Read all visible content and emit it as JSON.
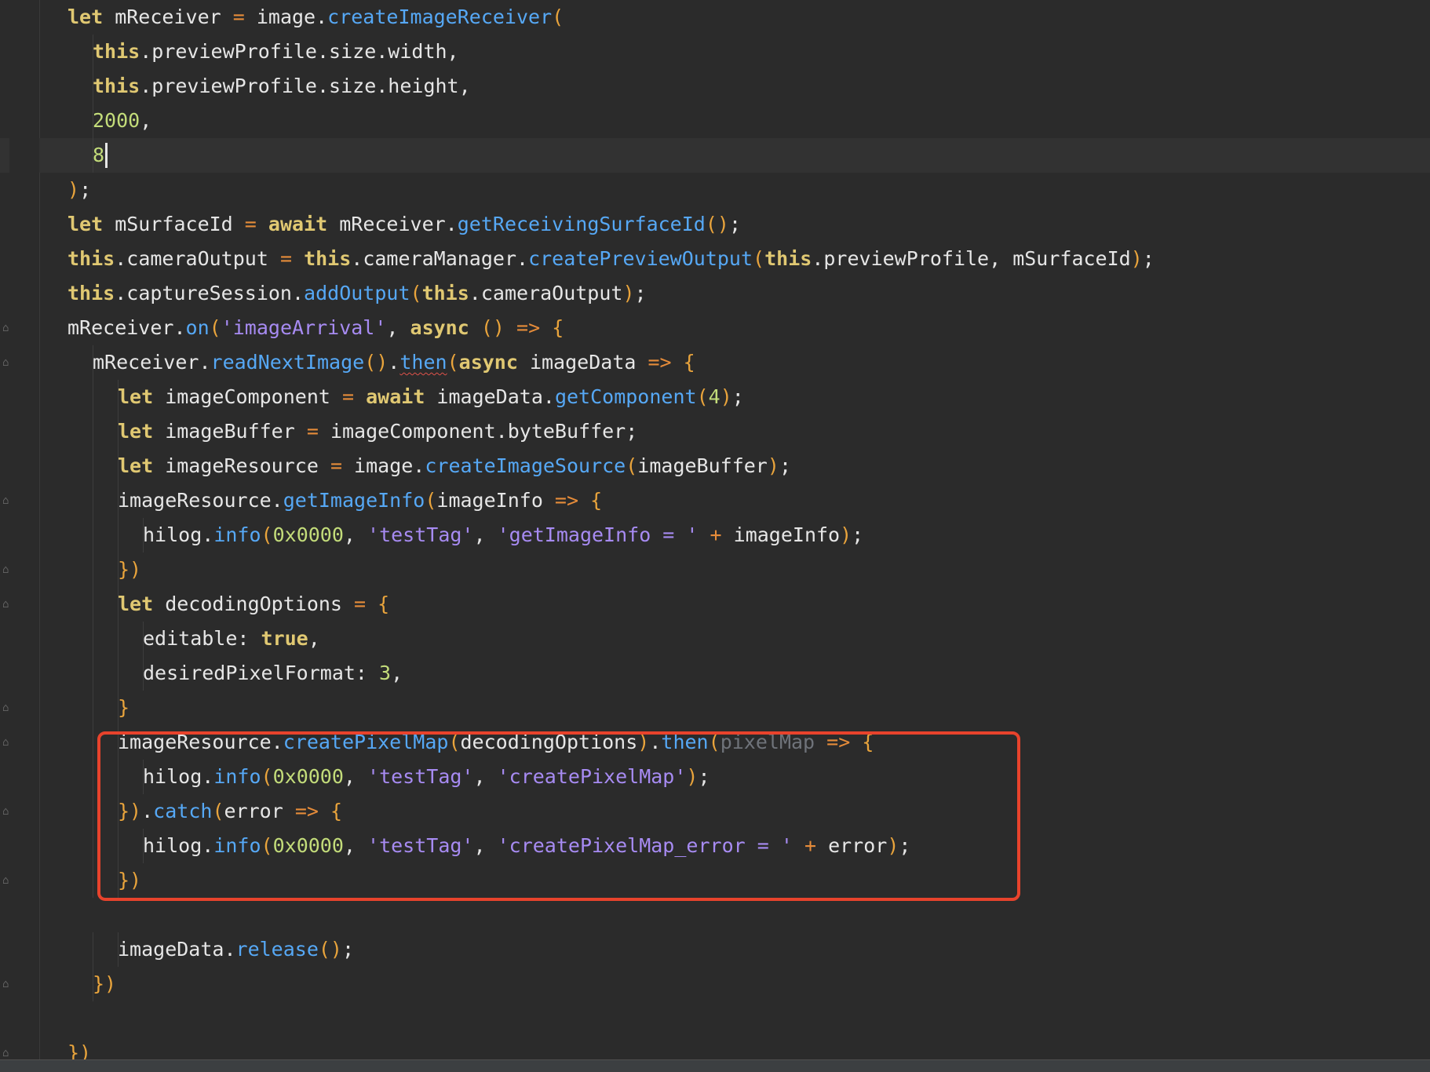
{
  "editor": {
    "highlight_color": "#e8432c",
    "caret_line": 4,
    "colors": {
      "background": "#2b2b2b",
      "keyword": "#e0c872",
      "function": "#56a8f5",
      "string": "#a78bf2",
      "number": "#c3dc7a",
      "bracket": "#e9a43c"
    },
    "lines": [
      {
        "indent": 0,
        "tokens": [
          [
            "kw",
            "let"
          ],
          [
            "pun",
            " mReceiver "
          ],
          [
            "op",
            "="
          ],
          [
            "pun",
            " image."
          ],
          [
            "fn",
            "createImageReceiver"
          ],
          [
            "br",
            "("
          ]
        ]
      },
      {
        "indent": 1,
        "tokens": [
          [
            "kw",
            "this"
          ],
          [
            "pun",
            ".previewProfile.size.width,"
          ]
        ]
      },
      {
        "indent": 1,
        "tokens": [
          [
            "kw",
            "this"
          ],
          [
            "pun",
            ".previewProfile.size.height,"
          ]
        ]
      },
      {
        "indent": 1,
        "tokens": [
          [
            "num",
            "2000"
          ],
          [
            "pun",
            ","
          ]
        ]
      },
      {
        "indent": 1,
        "tokens": [
          [
            "num",
            "8"
          ]
        ]
      },
      {
        "indent": 0,
        "tokens": [
          [
            "br",
            ")"
          ],
          [
            "pun",
            ";"
          ]
        ]
      },
      {
        "indent": 0,
        "tokens": [
          [
            "kw",
            "let"
          ],
          [
            "pun",
            " mSurfaceId "
          ],
          [
            "op",
            "="
          ],
          [
            "pun",
            " "
          ],
          [
            "kw",
            "await"
          ],
          [
            "pun",
            " mReceiver."
          ],
          [
            "fn",
            "getReceivingSurfaceId"
          ],
          [
            "br",
            "()"
          ],
          [
            "pun",
            ";"
          ]
        ]
      },
      {
        "indent": 0,
        "tokens": [
          [
            "kw",
            "this"
          ],
          [
            "pun",
            ".cameraOutput "
          ],
          [
            "op",
            "="
          ],
          [
            "pun",
            " "
          ],
          [
            "kw",
            "this"
          ],
          [
            "pun",
            ".cameraManager."
          ],
          [
            "fn",
            "createPreviewOutput"
          ],
          [
            "br",
            "("
          ],
          [
            "kw",
            "this"
          ],
          [
            "pun",
            ".previewProfile, mSurfaceId"
          ],
          [
            "br",
            ")"
          ],
          [
            "pun",
            ";"
          ]
        ]
      },
      {
        "indent": 0,
        "tokens": [
          [
            "kw",
            "this"
          ],
          [
            "pun",
            ".captureSession."
          ],
          [
            "fn",
            "addOutput"
          ],
          [
            "br",
            "("
          ],
          [
            "kw",
            "this"
          ],
          [
            "pun",
            ".cameraOutput"
          ],
          [
            "br",
            ")"
          ],
          [
            "pun",
            ";"
          ]
        ]
      },
      {
        "indent": 0,
        "tokens": [
          [
            "pun",
            "mReceiver."
          ],
          [
            "fn",
            "on"
          ],
          [
            "br",
            "("
          ],
          [
            "str",
            "'imageArrival'"
          ],
          [
            "pun",
            ", "
          ],
          [
            "kw",
            "async"
          ],
          [
            "pun",
            " "
          ],
          [
            "br",
            "()"
          ],
          [
            "pun",
            " "
          ],
          [
            "op",
            "=>"
          ],
          [
            "pun",
            " "
          ],
          [
            "br",
            "{"
          ]
        ]
      },
      {
        "indent": 1,
        "tokens": [
          [
            "pun",
            "mReceiver."
          ],
          [
            "fn",
            "readNextImage"
          ],
          [
            "br",
            "()"
          ],
          [
            "pun",
            "."
          ],
          [
            "fn squig",
            "then"
          ],
          [
            "br",
            "("
          ],
          [
            "kw",
            "async"
          ],
          [
            "pun",
            " imageData "
          ],
          [
            "op",
            "=>"
          ],
          [
            "pun",
            " "
          ],
          [
            "br",
            "{"
          ]
        ]
      },
      {
        "indent": 2,
        "tokens": [
          [
            "kw",
            "let"
          ],
          [
            "pun",
            " imageComponent "
          ],
          [
            "op",
            "="
          ],
          [
            "pun",
            " "
          ],
          [
            "kw",
            "await"
          ],
          [
            "pun",
            " imageData."
          ],
          [
            "fn",
            "getComponent"
          ],
          [
            "br",
            "("
          ],
          [
            "num",
            "4"
          ],
          [
            "br",
            ")"
          ],
          [
            "pun",
            ";"
          ]
        ]
      },
      {
        "indent": 2,
        "tokens": [
          [
            "kw",
            "let"
          ],
          [
            "pun",
            " imageBuffer "
          ],
          [
            "op",
            "="
          ],
          [
            "pun",
            " imageComponent.byteBuffer;"
          ]
        ]
      },
      {
        "indent": 2,
        "tokens": [
          [
            "kw",
            "let"
          ],
          [
            "pun",
            " imageResource "
          ],
          [
            "op",
            "="
          ],
          [
            "pun",
            " image."
          ],
          [
            "fn",
            "createImageSource"
          ],
          [
            "br",
            "("
          ],
          [
            "pun",
            "imageBuffer"
          ],
          [
            "br",
            ")"
          ],
          [
            "pun",
            ";"
          ]
        ]
      },
      {
        "indent": 2,
        "tokens": [
          [
            "pun",
            "imageResource."
          ],
          [
            "fn",
            "getImageInfo"
          ],
          [
            "br",
            "("
          ],
          [
            "pun",
            "imageInfo "
          ],
          [
            "op",
            "=>"
          ],
          [
            "pun",
            " "
          ],
          [
            "br",
            "{"
          ]
        ]
      },
      {
        "indent": 3,
        "tokens": [
          [
            "pun",
            "hilog."
          ],
          [
            "fn",
            "info"
          ],
          [
            "br",
            "("
          ],
          [
            "num",
            "0x0000"
          ],
          [
            "pun",
            ", "
          ],
          [
            "str",
            "'testTag'"
          ],
          [
            "pun",
            ", "
          ],
          [
            "str",
            "'getImageInfo = '"
          ],
          [
            "pun",
            " "
          ],
          [
            "op",
            "+"
          ],
          [
            "pun",
            " imageInfo"
          ],
          [
            "br",
            ")"
          ],
          [
            "pun",
            ";"
          ]
        ]
      },
      {
        "indent": 2,
        "tokens": [
          [
            "br",
            "})"
          ]
        ]
      },
      {
        "indent": 2,
        "tokens": [
          [
            "kw",
            "let"
          ],
          [
            "pun",
            " decodingOptions "
          ],
          [
            "op",
            "="
          ],
          [
            "pun",
            " "
          ],
          [
            "br",
            "{"
          ]
        ]
      },
      {
        "indent": 3,
        "tokens": [
          [
            "pun",
            "editable: "
          ],
          [
            "kw",
            "true"
          ],
          [
            "pun",
            ","
          ]
        ]
      },
      {
        "indent": 3,
        "tokens": [
          [
            "pun",
            "desiredPixelFormat: "
          ],
          [
            "num",
            "3"
          ],
          [
            "pun",
            ","
          ]
        ]
      },
      {
        "indent": 2,
        "tokens": [
          [
            "br",
            "}"
          ]
        ]
      },
      {
        "indent": 2,
        "tokens": [
          [
            "pun",
            "imageResource."
          ],
          [
            "fn",
            "createPixelMap"
          ],
          [
            "br",
            "("
          ],
          [
            "pun",
            "decodingOptions"
          ],
          [
            "br",
            ")"
          ],
          [
            "pun",
            "."
          ],
          [
            "fn",
            "then"
          ],
          [
            "br",
            "("
          ],
          [
            "hint",
            "pixelMap"
          ],
          [
            "pun",
            " "
          ],
          [
            "op",
            "=>"
          ],
          [
            "pun",
            " "
          ],
          [
            "br",
            "{"
          ]
        ]
      },
      {
        "indent": 3,
        "tokens": [
          [
            "pun",
            "hilog."
          ],
          [
            "fn",
            "info"
          ],
          [
            "br",
            "("
          ],
          [
            "num",
            "0x0000"
          ],
          [
            "pun",
            ", "
          ],
          [
            "str",
            "'testTag'"
          ],
          [
            "pun",
            ", "
          ],
          [
            "str",
            "'createPixelMap'"
          ],
          [
            "br",
            ")"
          ],
          [
            "pun",
            ";"
          ]
        ]
      },
      {
        "indent": 2,
        "tokens": [
          [
            "br",
            "})"
          ],
          [
            "pun",
            "."
          ],
          [
            "fn",
            "catch"
          ],
          [
            "br",
            "("
          ],
          [
            "pun",
            "error "
          ],
          [
            "op",
            "=>"
          ],
          [
            "pun",
            " "
          ],
          [
            "br",
            "{"
          ]
        ]
      },
      {
        "indent": 3,
        "tokens": [
          [
            "pun",
            "hilog."
          ],
          [
            "fn",
            "info"
          ],
          [
            "br",
            "("
          ],
          [
            "num",
            "0x0000"
          ],
          [
            "pun",
            ", "
          ],
          [
            "str",
            "'testTag'"
          ],
          [
            "pun",
            ", "
          ],
          [
            "str",
            "'createPixelMap_error = '"
          ],
          [
            "pun",
            " "
          ],
          [
            "op",
            "+"
          ],
          [
            "pun",
            " error"
          ],
          [
            "br",
            ")"
          ],
          [
            "pun",
            ";"
          ]
        ]
      },
      {
        "indent": 2,
        "tokens": [
          [
            "br",
            "})"
          ]
        ]
      },
      {
        "indent": 0,
        "tokens": []
      },
      {
        "indent": 2,
        "tokens": [
          [
            "pun",
            "imageData."
          ],
          [
            "fn",
            "release"
          ],
          [
            "br",
            "()"
          ],
          [
            "pun",
            ";"
          ]
        ]
      },
      {
        "indent": 1,
        "tokens": [
          [
            "br",
            "})"
          ]
        ]
      },
      {
        "indent": 0,
        "tokens": []
      },
      {
        "indent": 0,
        "tokens": [
          [
            "br",
            "})"
          ]
        ]
      }
    ]
  }
}
